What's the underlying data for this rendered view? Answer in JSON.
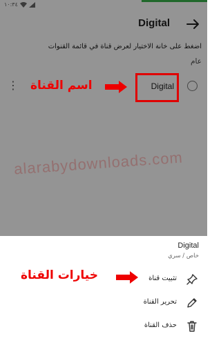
{
  "app_bar": {
    "title": "Digital"
  },
  "status_bar": {
    "time": "١٠:٣٤"
  },
  "instruction": "اضغط على خانة الاختيار لعرض قناة في قائمة القنوات",
  "section": {
    "label": "عام"
  },
  "channel": {
    "name": "Digital"
  },
  "annotations": {
    "channel_name": "اسم القناة",
    "channel_options": "خيارات القناة"
  },
  "watermark": "alarabydownloads.com",
  "sheet": {
    "title": "Digital",
    "subtitle": "خاص / سري",
    "items": [
      {
        "label": "تثبيت قناة",
        "icon": "pin-icon"
      },
      {
        "label": "تحرير القناة",
        "icon": "pencil-icon"
      },
      {
        "label": "حذف القناة",
        "icon": "trash-icon"
      }
    ]
  },
  "colors": {
    "annotation_red": "#ee0000",
    "scrim": "rgba(0,0,0,0.42)",
    "progress_green": "#38b34a"
  }
}
